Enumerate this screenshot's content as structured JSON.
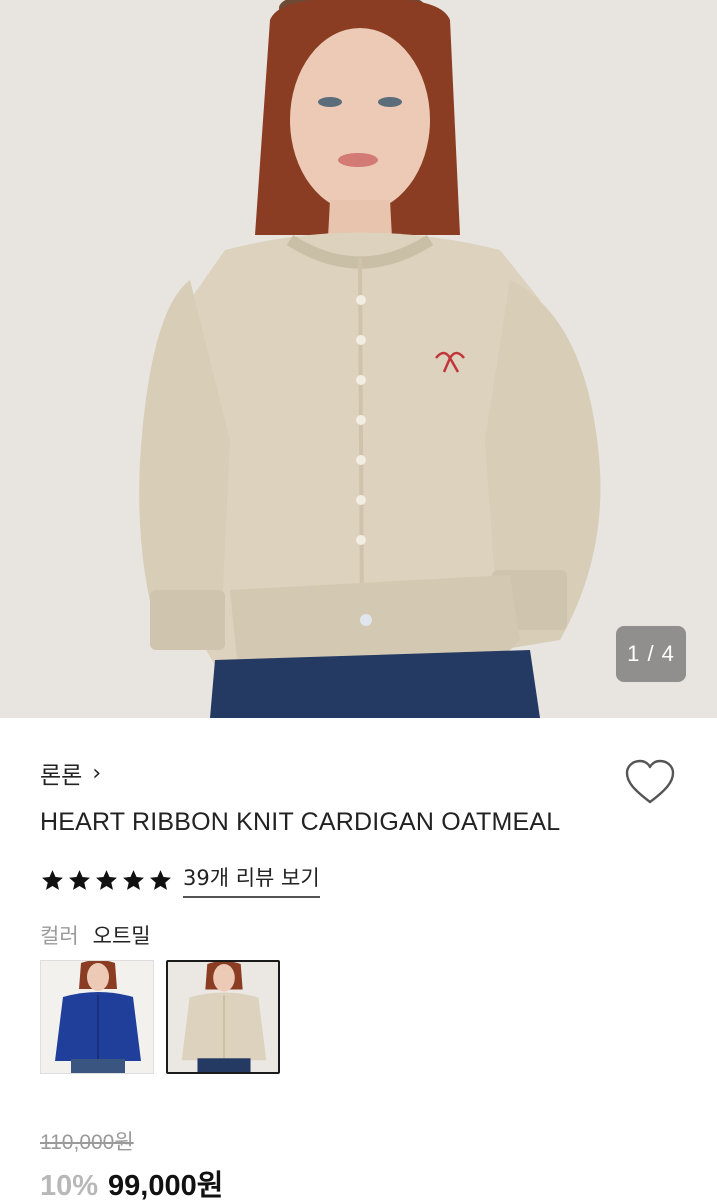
{
  "hero": {
    "pager": "1 / 4",
    "image_alt": "Model wearing oatmeal knit cardigan with red ribbon embroidery"
  },
  "product": {
    "brand": "론론",
    "name": "HEART RIBBON KNIT CARDIGAN OATMEAL",
    "rating_stars": 5,
    "review_link": "39개 리뷰 보기",
    "color_label": "컬러",
    "color_value": "오트밀",
    "swatches": [
      {
        "name": "blue",
        "selected": false
      },
      {
        "name": "oatmeal",
        "selected": true
      }
    ],
    "original_price": "110,000원",
    "discount": "10%",
    "sale_price": "99,000원"
  },
  "icons": {
    "wishlist": "heart-outline-icon",
    "brand_chevron": "chevron-right-icon",
    "star": "star-icon"
  },
  "colors": {
    "text": "#1a1a1a",
    "muted": "#9a9a9a",
    "discount": "#b8b8b8",
    "cardigan": "#dcd2bd",
    "jeans": "#243a63"
  }
}
